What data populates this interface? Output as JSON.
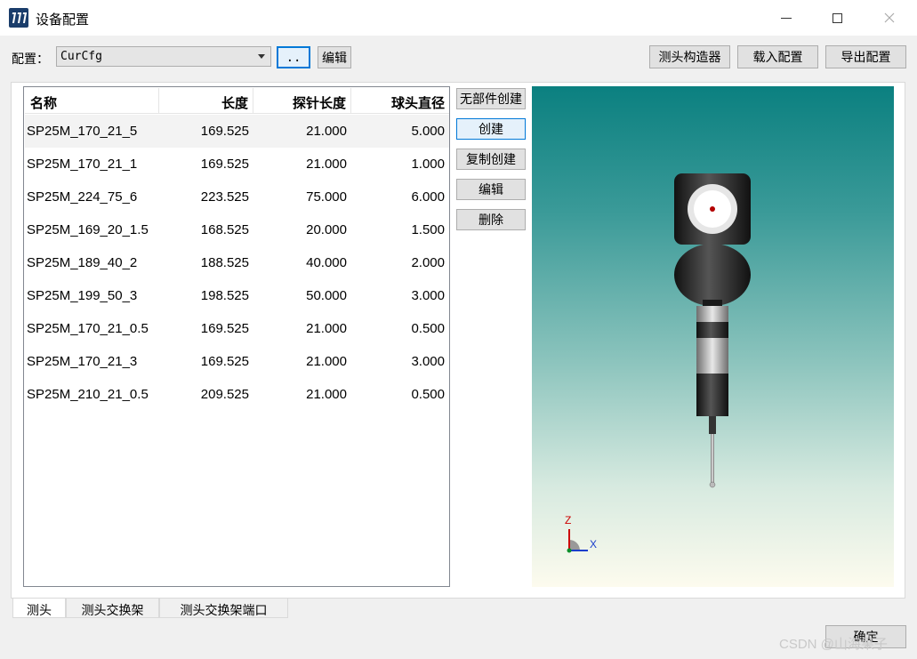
{
  "window": {
    "title": "设备配置",
    "controls": {
      "minimize": "—",
      "maximize": "☐",
      "close": "✕"
    }
  },
  "toolbar": {
    "config_label": "配置：",
    "config_value": "CurCfg",
    "browse_label": "..",
    "edit_label": "编辑",
    "builder_label": "测头构造器",
    "load_label": "载入配置",
    "export_label": "导出配置"
  },
  "table": {
    "columns": [
      "名称",
      "长度",
      "探针长度",
      "球头直径"
    ],
    "rows": [
      {
        "name": "SP25M_170_21_5",
        "length": "169.525",
        "probe_length": "21.000",
        "ball_diameter": "5.000"
      },
      {
        "name": "SP25M_170_21_1",
        "length": "169.525",
        "probe_length": "21.000",
        "ball_diameter": "1.000"
      },
      {
        "name": "SP25M_224_75_6",
        "length": "223.525",
        "probe_length": "75.000",
        "ball_diameter": "6.000"
      },
      {
        "name": "SP25M_169_20_1.5",
        "length": "168.525",
        "probe_length": "20.000",
        "ball_diameter": "1.500"
      },
      {
        "name": "SP25M_189_40_2",
        "length": "188.525",
        "probe_length": "40.000",
        "ball_diameter": "2.000"
      },
      {
        "name": "SP25M_199_50_3",
        "length": "198.525",
        "probe_length": "50.000",
        "ball_diameter": "3.000"
      },
      {
        "name": "SP25M_170_21_0.5",
        "length": "169.525",
        "probe_length": "21.000",
        "ball_diameter": "0.500"
      },
      {
        "name": "SP25M_170_21_3",
        "length": "169.525",
        "probe_length": "21.000",
        "ball_diameter": "3.000"
      },
      {
        "name": "SP25M_210_21_0.5",
        "length": "209.525",
        "probe_length": "21.000",
        "ball_diameter": "0.500"
      }
    ]
  },
  "side_buttons": [
    "无部件创建",
    "创建",
    "复制创建",
    "编辑",
    "删除"
  ],
  "viewport": {
    "axis_labels": {
      "z": "Z",
      "x": "X"
    }
  },
  "tabs": [
    "测头",
    "测头交换架",
    "测头交换架端口"
  ],
  "footer": {
    "ok_label": "确定",
    "watermark": "CSDN @山海果子"
  }
}
